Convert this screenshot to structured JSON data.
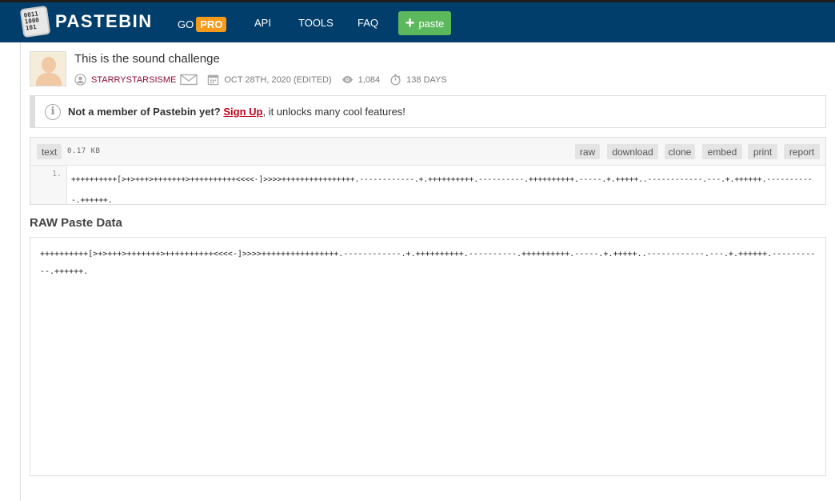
{
  "header": {
    "logo_binary": "0011 1000 101",
    "logo_text": "PASTEBIN",
    "nav": [
      {
        "label": "GO"
      },
      {
        "label": "API"
      },
      {
        "label": "TOOLS"
      },
      {
        "label": "FAQ"
      }
    ],
    "pro_badge": "PRO",
    "paste_button": "paste"
  },
  "paste": {
    "title": "This is the sound challenge",
    "author": "STARRYSTARSISME",
    "date": "OCT 28TH, 2020 (EDITED)",
    "views": "1,084",
    "expires": "138 DAYS"
  },
  "notice": {
    "lead": "Not a member of Pastebin yet?",
    "signup": "Sign Up",
    "rest": ", it unlocks many cool features!"
  },
  "code": {
    "syntax": "text",
    "size": "0.17 KB",
    "actions": [
      "raw",
      "download",
      "clone",
      "embed",
      "print",
      "report"
    ],
    "line_number": "1.",
    "content": "++++++++++[>+>+++>+++++++>++++++++++<<<<-]>>>>++++++++++++++++.------------.+.++++++++++.----------.++++++++++.-----.+.+++++..------------.---.+.++++++.-----------.++++++."
  },
  "raw": {
    "heading": "RAW Paste Data",
    "content": "++++++++++[>+>+++>+++++++>++++++++++<<<<-]>>>>++++++++++++++++.------------.+.++++++++++.----------.++++++++++.-----.+.+++++..------------.---.+.++++++.-----------.++++++."
  },
  "colors": {
    "header_bg": "#023e6b",
    "pro": "#f59a1b",
    "paste_button": "#5cb85c",
    "author": "#8e0b38",
    "signup": "#c0001a"
  },
  "icons": [
    "logo-icon",
    "plus-icon",
    "user-icon",
    "envelope-icon",
    "calendar-icon",
    "eye-icon",
    "stopwatch-icon",
    "info-icon"
  ]
}
